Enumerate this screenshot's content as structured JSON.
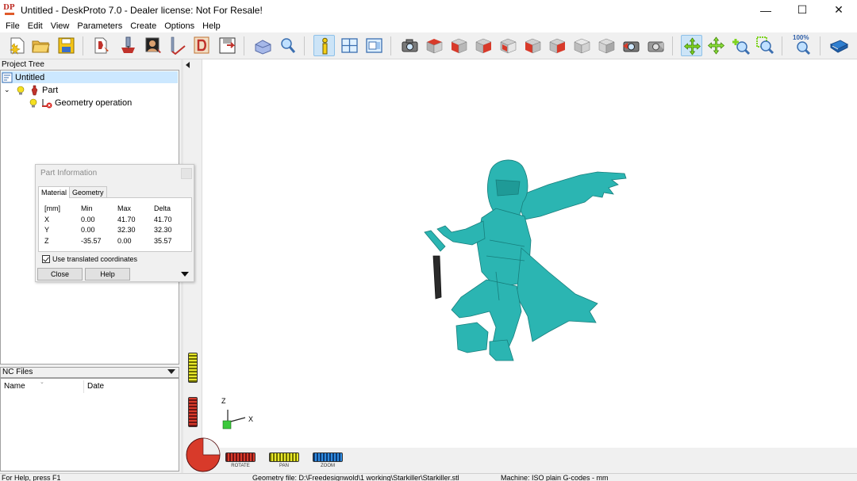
{
  "window": {
    "title": "Untitled - DeskProto 7.0 - Dealer license: Not For Resale!",
    "icon_text": "DP",
    "minimize_glyph": "—",
    "maximize_glyph": "☐",
    "close_glyph": "✕"
  },
  "menu": [
    "File",
    "Edit",
    "View",
    "Parameters",
    "Create",
    "Options",
    "Help"
  ],
  "toolbar": {
    "icons": [
      "new-project-icon",
      "open-project-icon",
      "save-project-icon",
      "load-part-icon",
      "load-vector-icon",
      "load-bitmap-icon",
      "toolpath-icon",
      "drawing-icon",
      "export-icon",
      "shaded-view-icon",
      "lens-icon",
      "part-info-icon",
      "window-layout-icon",
      "preview-icon",
      "camera-icon",
      "view-top-icon",
      "view-front-icon",
      "view-left-icon",
      "view-right-icon",
      "view-back-icon",
      "view-bottom-icon",
      "view-iso-1-icon",
      "view-iso-2-icon",
      "redraw-icon",
      "redraw-alt-icon",
      "rotate-mode-icon",
      "pan-mode-icon",
      "zoom-mode-icon",
      "zoom-window-icon",
      "zoom-100-icon",
      "help-book-icon"
    ],
    "zoom_label": "100%"
  },
  "project_tree": {
    "header": "Project Tree",
    "items": [
      {
        "label": "Untitled",
        "level": 0,
        "selected": true
      },
      {
        "label": "Part",
        "level": 1,
        "selected": false
      },
      {
        "label": "Geometry operation",
        "level": 2,
        "selected": false
      }
    ]
  },
  "nc_files": {
    "header": "NC Files",
    "columns": [
      "Name",
      "Date"
    ]
  },
  "part_info": {
    "title": "Part Information",
    "tabs": [
      "Material",
      "Geometry"
    ],
    "active_tab": "Material",
    "headers": [
      "[mm]",
      "Min",
      "Max",
      "Delta"
    ],
    "rows": [
      [
        "X",
        "0.00",
        "41.70",
        "41.70"
      ],
      [
        "Y",
        "0.00",
        "32.30",
        "32.30"
      ],
      [
        "Z",
        "-35.57",
        "0.00",
        "35.57"
      ]
    ],
    "checkbox_label": "Use translated coordinates",
    "checkbox_checked": true,
    "close_label": "Close",
    "help_label": "Help"
  },
  "viewport": {
    "model_color": "#2bb5b2",
    "axis_x": "X",
    "axis_z": "Z",
    "rollers": [
      "ROTATE",
      "PAN",
      "ZOOM"
    ]
  },
  "status": {
    "help": "For Help, press F1",
    "geometry": "Geometry file: D:\\Freedesignwold\\1 working\\Starkiller\\Starkiller.stl",
    "machine": "Machine: ISO plain G-codes - mm"
  }
}
